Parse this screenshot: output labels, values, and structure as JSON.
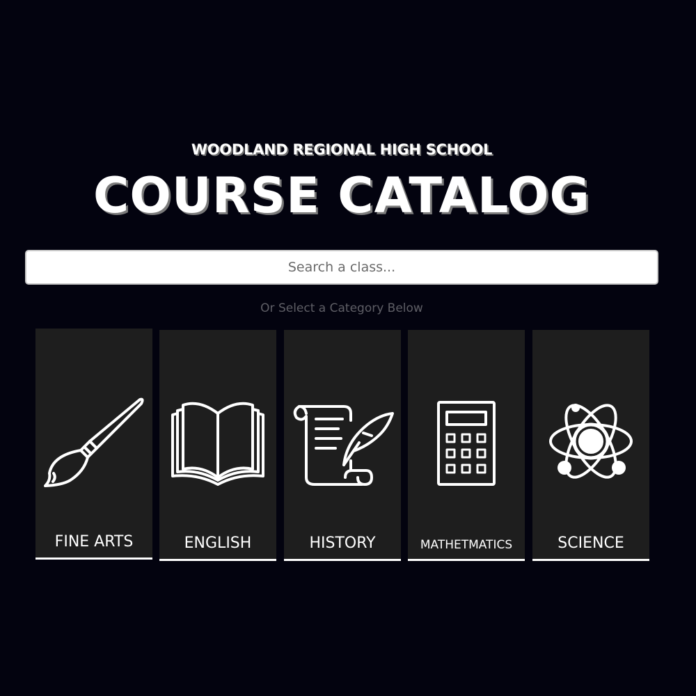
{
  "header": {
    "school_name": "WOODLAND REGIONAL HIGH SCHOOL",
    "title": "COURSE CATALOG"
  },
  "search": {
    "placeholder": "Search a class...",
    "value": ""
  },
  "category_hint": "Or Select a Category Below",
  "categories": [
    {
      "label": "FINE ARTS",
      "icon": "paintbrush-icon"
    },
    {
      "label": "ENGLISH",
      "icon": "open-book-icon"
    },
    {
      "label": "HISTORY",
      "icon": "scroll-quill-icon"
    },
    {
      "label": "MATHETMATICS",
      "icon": "calculator-icon"
    },
    {
      "label": "SCIENCE",
      "icon": "atom-icon"
    }
  ],
  "colors": {
    "background": "#03030f",
    "card": "#1e1e1e",
    "text": "#ffffff",
    "hint": "#5f5f66"
  }
}
